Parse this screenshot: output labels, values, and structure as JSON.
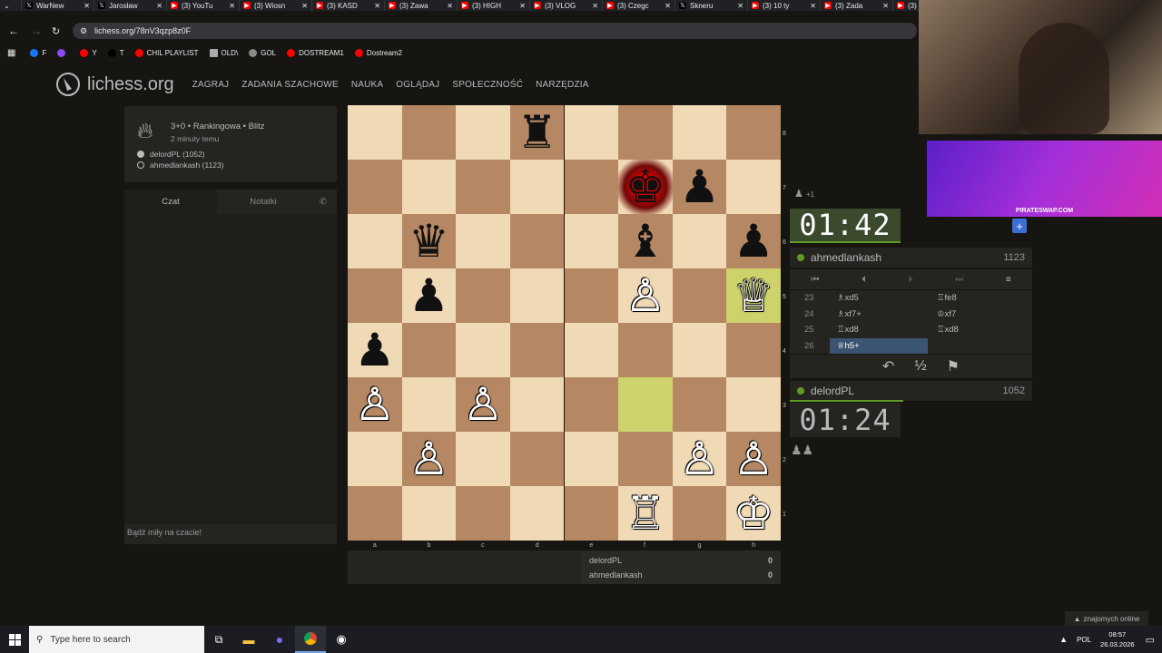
{
  "browser": {
    "tabs": [
      {
        "title": "WarNew",
        "icon": "x-icon",
        "color": "#000000"
      },
      {
        "title": "Jarosław",
        "icon": "x-icon",
        "color": "#000000"
      },
      {
        "title": "(3) YouTu",
        "icon": "youtube-icon",
        "color": "#ff0000"
      },
      {
        "title": "(3) Wiosn",
        "icon": "youtube-icon",
        "color": "#ff0000"
      },
      {
        "title": "(3) KASD",
        "icon": "youtube-icon",
        "color": "#ff0000"
      },
      {
        "title": "(3) Zawa",
        "icon": "youtube-icon",
        "color": "#ff0000"
      },
      {
        "title": "(3) HIGH",
        "icon": "youtube-icon",
        "color": "#ff0000"
      },
      {
        "title": "(3) VLOG",
        "icon": "youtube-icon",
        "color": "#ff0000"
      },
      {
        "title": "(3) Czegc",
        "icon": "youtube-icon",
        "color": "#ff0000"
      },
      {
        "title": "Skneru",
        "icon": "x-icon",
        "color": "#000000"
      },
      {
        "title": "(3) 10 ty",
        "icon": "youtube-icon",
        "color": "#ff0000"
      },
      {
        "title": "(3) Zada",
        "icon": "youtube-icon",
        "color": "#ff0000"
      },
      {
        "title": "(3)",
        "icon": "youtube-icon",
        "color": "#ff0000"
      }
    ],
    "url": "lichess.org/78nV3qzp8z0F",
    "bookmarks": [
      {
        "label": "F",
        "icon": "facebook-icon",
        "color": "#1877f2"
      },
      {
        "label": "",
        "icon": "twitch-icon",
        "color": "#9146ff"
      },
      {
        "label": "Y",
        "icon": "youtube-icon",
        "color": "#ff0000"
      },
      {
        "label": "T",
        "icon": "x-icon",
        "color": "#000000"
      },
      {
        "label": "CHIL PLAYLIST",
        "icon": "youtube-icon",
        "color": "#ff0000"
      },
      {
        "label": "OLD\\",
        "icon": "folder-icon",
        "color": "#aaaaaa"
      },
      {
        "label": "GOL",
        "icon": "g-icon",
        "color": "#888888"
      },
      {
        "label": "DOSTREAM1",
        "icon": "youtube-icon",
        "color": "#ff0000"
      },
      {
        "label": "Dostream2",
        "icon": "youtube-icon",
        "color": "#ff0000"
      }
    ]
  },
  "site": {
    "logo": "lichess.org",
    "nav": [
      "ZAGRAJ",
      "ZADANIA SZACHOWE",
      "NAUKA",
      "OGLĄDAJ",
      "SPOŁECZNOŚĆ",
      "NARZĘDZIA"
    ]
  },
  "game_info": {
    "type": "3+0 • Rankingowa • Blitz",
    "time": "2 minuty temu",
    "white_player": "delordPL (1052)",
    "black_player": "ahmedlankash (1123)"
  },
  "chat": {
    "tab_chat": "Czat",
    "tab_notes": "Notatki",
    "placeholder": "Bądź miły na czacie!"
  },
  "board": {
    "files": [
      "a",
      "b",
      "c",
      "d",
      "e",
      "f",
      "g",
      "h"
    ],
    "ranks": [
      "8",
      "7",
      "6",
      "5",
      "4",
      "3",
      "2",
      "1"
    ],
    "rows": [
      [
        "",
        "",
        "",
        "♜",
        "",
        "",
        "",
        ""
      ],
      [
        "",
        "",
        "",
        "",
        "",
        "♚",
        "♟",
        ""
      ],
      [
        "",
        "♛",
        "",
        "",
        "",
        "♝",
        "",
        "♟"
      ],
      [
        "",
        "♟",
        "",
        "",
        "",
        "♙",
        "",
        "♕"
      ],
      [
        "♟",
        "",
        "",
        "",
        "",
        "",
        "",
        ""
      ],
      [
        "♙",
        "",
        "♙",
        "",
        "",
        "",
        "",
        ""
      ],
      [
        "",
        "♙",
        "",
        "",
        "",
        "",
        "♙",
        "♙"
      ],
      [
        "",
        "",
        "",
        "",
        "",
        "♖",
        "",
        "♔"
      ]
    ],
    "last_move": [
      "f3",
      "h5"
    ],
    "check_square": "f7"
  },
  "opponent": {
    "name": "ahmedlankash",
    "rating": "1123",
    "clock": "01:42",
    "material": "+1"
  },
  "player": {
    "name": "delordPL",
    "rating": "1052",
    "clock": "01:24"
  },
  "moves": [
    {
      "n": "23",
      "white": "♗xd5",
      "black": "♖fe8"
    },
    {
      "n": "24",
      "white": "♗xf7+",
      "black": "♔xf7"
    },
    {
      "n": "25",
      "white": "♖xd8",
      "black": "♖xd8"
    },
    {
      "n": "26",
      "white": "♕h5+",
      "black": ""
    }
  ],
  "crowd": [
    {
      "name": "delordPL",
      "score": "0"
    },
    {
      "name": "ahmedlankash",
      "score": "0"
    }
  ],
  "friends_online": "znajomych online",
  "stream_overlay": {
    "ad_text": "PIRATESWAP.COM"
  },
  "taskbar": {
    "search_placeholder": "Type here to search",
    "lang": "POL",
    "time": "08:57",
    "date": "26.03.2026"
  }
}
